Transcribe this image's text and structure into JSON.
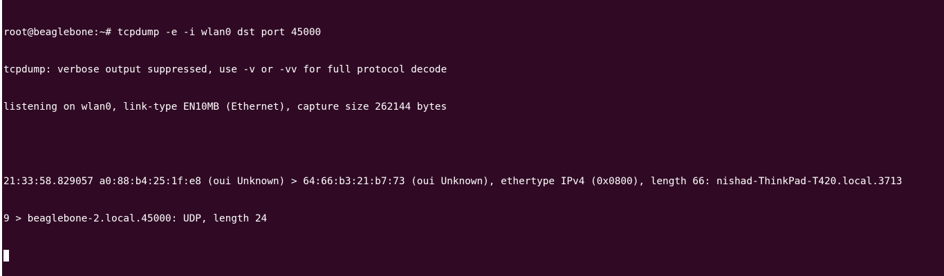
{
  "terminal": {
    "background_color": "#300a24",
    "text_color": "#ffffff",
    "lines": [
      "root@beaglebone:~# tcpdump -e -i wlan0 dst port 45000",
      "tcpdump: verbose output suppressed, use -v or -vv for full protocol decode",
      "listening on wlan0, link-type EN10MB (Ethernet), capture size 262144 bytes",
      "",
      "21:33:58.829057 a0:88:b4:25:1f:e8 (oui Unknown) > 64:66:b3:21:b7:73 (oui Unknown), ethertype IPv4 (0x0800), length 66: nishad-ThinkPad-T420.local.3713",
      "9 > beaglebone-2.local.45000: UDP, length 24"
    ]
  }
}
